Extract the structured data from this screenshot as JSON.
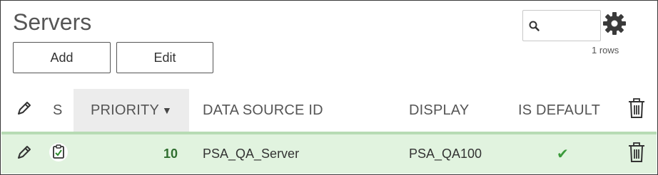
{
  "panel": {
    "title": "Servers",
    "buttons": {
      "add": "Add",
      "edit": "Edit"
    },
    "search": {
      "value": "",
      "placeholder": ""
    },
    "rows_count": "1 rows",
    "icons": {
      "search": "search-icon",
      "settings": "gear-icon"
    }
  },
  "table": {
    "columns": {
      "edit": "edit-pencil-icon",
      "s": "S",
      "priority": "PRIORITY",
      "sort_indicator": "▼",
      "data_source_id": "DATA SOURCE ID",
      "display": "DISPLAY",
      "is_default": "IS DEFAULT",
      "delete": "trash-icon"
    },
    "rows": [
      {
        "priority": "10",
        "data_source_id": "PSA_QA_Server",
        "display": "PSA_QA100",
        "is_default": "✔"
      }
    ]
  },
  "colors": {
    "row_highlight": "#e1f3df",
    "header_divider": "#b7dbb4",
    "sorted_header_bg": "#ececec",
    "check_green": "#3b9a3b"
  }
}
